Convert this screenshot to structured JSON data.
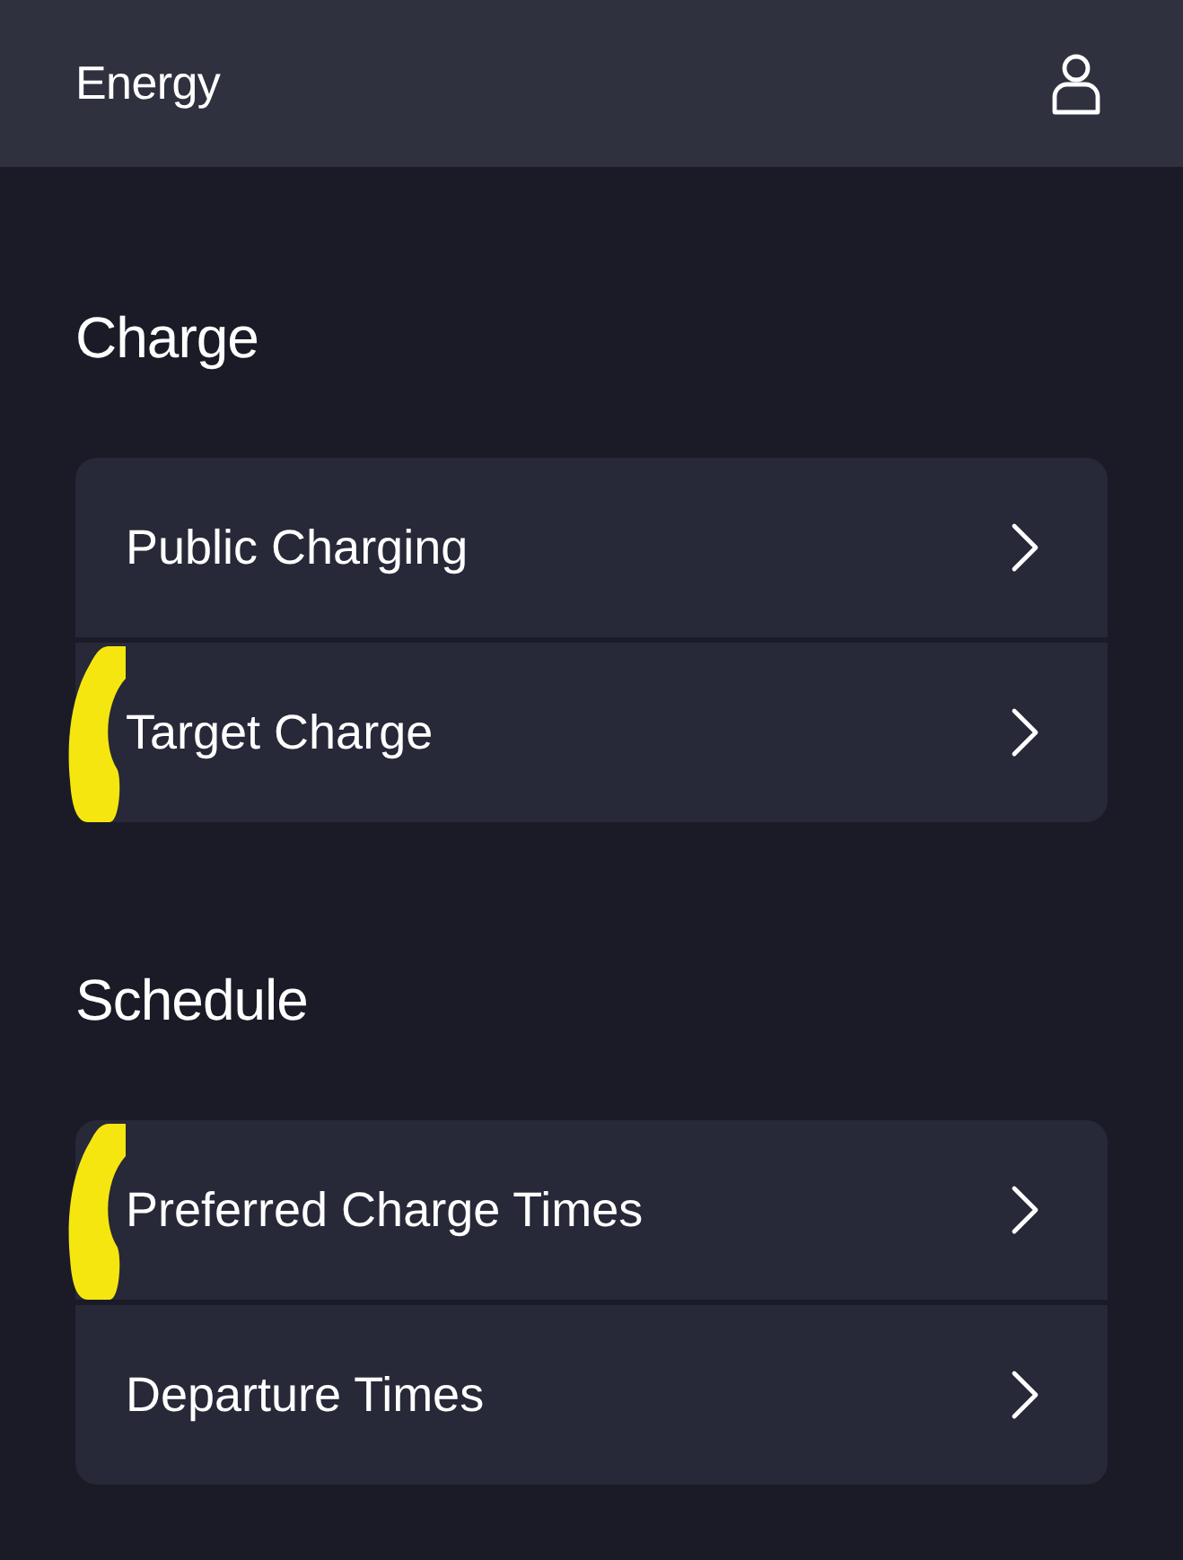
{
  "header": {
    "title": "Energy"
  },
  "sections": [
    {
      "heading": "Charge",
      "items": [
        {
          "label": "Public Charging",
          "highlighted": false
        },
        {
          "label": "Target Charge",
          "highlighted": true
        }
      ]
    },
    {
      "heading": "Schedule",
      "items": [
        {
          "label": "Preferred Charge Times",
          "highlighted": true
        },
        {
          "label": "Departure Times",
          "highlighted": false
        }
      ]
    }
  ]
}
